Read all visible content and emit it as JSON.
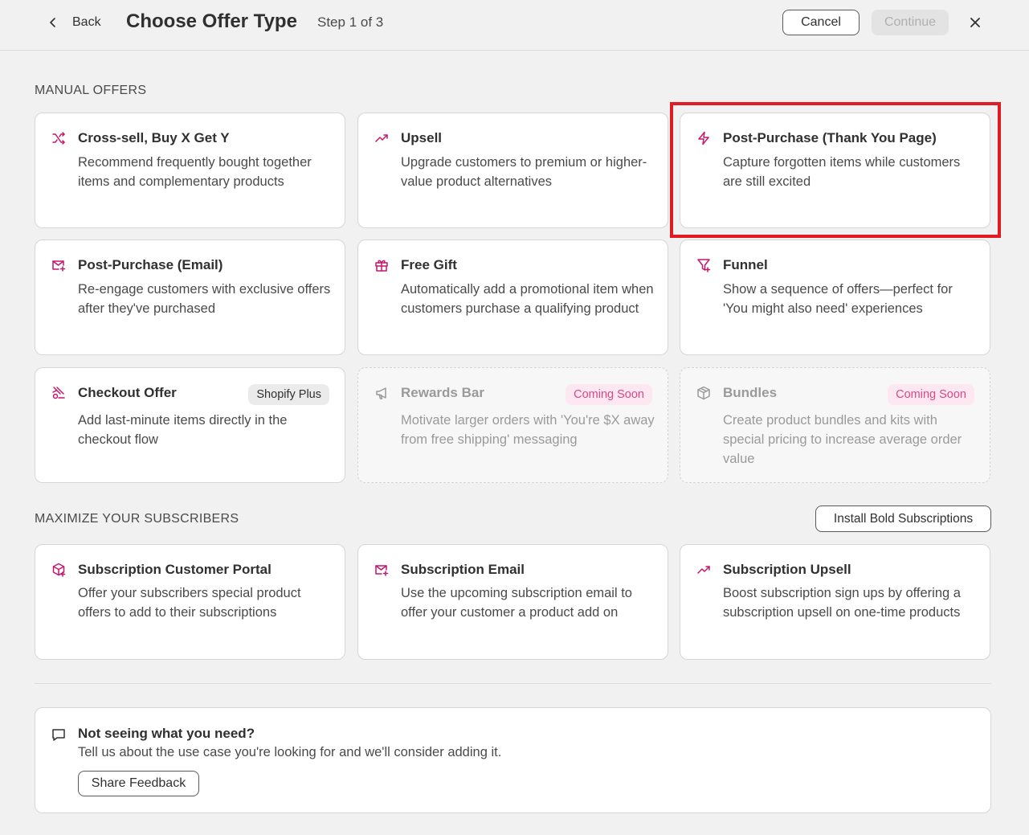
{
  "colors": {
    "accent": "#c4166c",
    "highlight": "#e01b24",
    "coming_soon_bg": "#fde7f1",
    "coming_soon_text": "#d9488a"
  },
  "header": {
    "back_label": "Back",
    "title": "Choose Offer Type",
    "step": "Step 1 of 3",
    "cancel_label": "Cancel",
    "continue_label": "Continue"
  },
  "manual": {
    "label": "MANUAL OFFERS",
    "cards": [
      {
        "title": "Cross-sell, Buy X Get Y",
        "desc": "Recommend frequently bought together items and complementary products",
        "icon": "shuffle-icon"
      },
      {
        "title": "Upsell",
        "desc": "Upgrade customers to premium or higher-value product alternatives",
        "icon": "trending-up-icon"
      },
      {
        "title": "Post-Purchase (Thank You Page)",
        "desc": "Capture forgotten items while customers are still excited",
        "icon": "lightning-icon"
      },
      {
        "title": "Post-Purchase (Email)",
        "desc": "Re-engage customers with exclusive offers after they've purchased",
        "icon": "email-icon"
      },
      {
        "title": "Free Gift",
        "desc": "Automatically add a promotional item when customers purchase a qualifying product",
        "icon": "gift-icon"
      },
      {
        "title": "Funnel",
        "desc": "Show a sequence of offers—perfect for 'You might also need' experiences",
        "icon": "funnel-icon"
      },
      {
        "title": "Checkout Offer",
        "desc": "Add last-minute items directly in the checkout flow",
        "icon": "checkout-icon",
        "badge": "Shopify Plus"
      },
      {
        "title": "Rewards Bar",
        "desc": "Motivate larger orders with 'You're $X away from free shipping' messaging",
        "icon": "megaphone-icon",
        "badge": "Coming Soon"
      },
      {
        "title": "Bundles",
        "desc": "Create product bundles and kits with special pricing to increase average order value",
        "icon": "package-icon",
        "badge": "Coming Soon"
      }
    ]
  },
  "subscribers": {
    "label": "MAXIMIZE YOUR SUBSCRIBERS",
    "install_label": "Install Bold Subscriptions",
    "cards": [
      {
        "title": "Subscription Customer Portal",
        "desc": "Offer your subscribers special product offers to add to their subscriptions",
        "icon": "portal-icon"
      },
      {
        "title": "Subscription Email",
        "desc": "Use the upcoming subscription email to offer your customer a product add on",
        "icon": "email-icon"
      },
      {
        "title": "Subscription Upsell",
        "desc": "Boost subscription sign ups by offering a subscription upsell on one-time products",
        "icon": "trending-up-icon"
      }
    ]
  },
  "feedback": {
    "title": "Not seeing what you need?",
    "desc": "Tell us about the use case you're looking for and we'll consider adding it.",
    "button_label": "Share Feedback"
  }
}
